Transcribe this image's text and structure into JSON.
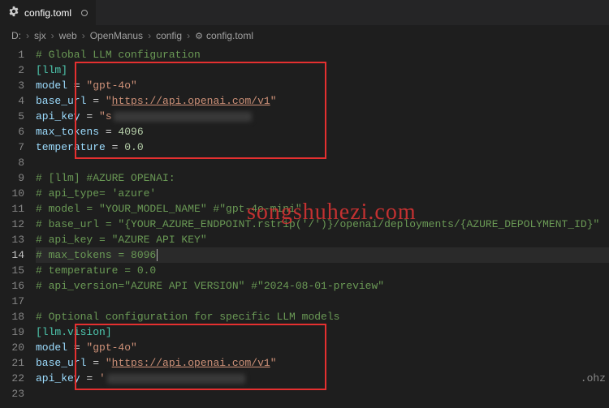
{
  "tab": {
    "title": "config.toml"
  },
  "breadcrumbs": [
    "D:",
    "sjx",
    "web",
    "OpenManus",
    "config",
    "config.toml"
  ],
  "watermark": "songshuhezi.com",
  "code": {
    "l1_comment": "# Global LLM configuration",
    "l2_section": "[llm]",
    "l3_key": "model",
    "l3_val": "\"gpt-4o\"",
    "l4_key": "base_url",
    "l4_prefix": "\"",
    "l4_url": "https://api.openai.com/v1",
    "l4_suffix": "\"",
    "l5_key": "api_key",
    "l5_val_prefix": "\"s",
    "l6_key": "max_tokens",
    "l6_val": "4096",
    "l7_key": "temperature",
    "l7_val": "0.0",
    "l9_comment": "# [llm] #AZURE OPENAI:",
    "l10_comment": "# api_type= 'azure'",
    "l11_comment": "# model = \"YOUR_MODEL_NAME\" #\"gpt-4o-mini\"",
    "l12_comment": "# base_url = \"{YOUR_AZURE_ENDPOINT.rstrip('/')}/openai/deployments/{AZURE_DEPOLYMENT_ID}\"",
    "l13_comment": "# api_key = \"AZURE API KEY\"",
    "l14_comment_a": "# max_tokens = ",
    "l14_comment_b": "8096",
    "l15_comment": "# temperature = 0.0",
    "l16_comment": "# api_version=\"AZURE API VERSION\" #\"2024-08-01-preview\"",
    "l18_comment": "# Optional configuration for specific LLM models",
    "l19_section": "[llm.vision]",
    "l20_key": "model",
    "l20_val": "\"gpt-4o\"",
    "l21_key": "base_url",
    "l21_prefix": "\"",
    "l21_url": "https://api.openai.com/v1",
    "l21_suffix": "\"",
    "l22_key": "api_key",
    "l22_val_prefix": "'",
    "l22_trail": ".ohz"
  },
  "lineNumbers": [
    "1",
    "2",
    "3",
    "4",
    "5",
    "6",
    "7",
    "8",
    "9",
    "10",
    "11",
    "12",
    "13",
    "14",
    "15",
    "16",
    "17",
    "18",
    "19",
    "20",
    "21",
    "22",
    "23"
  ],
  "currentLine": 14
}
